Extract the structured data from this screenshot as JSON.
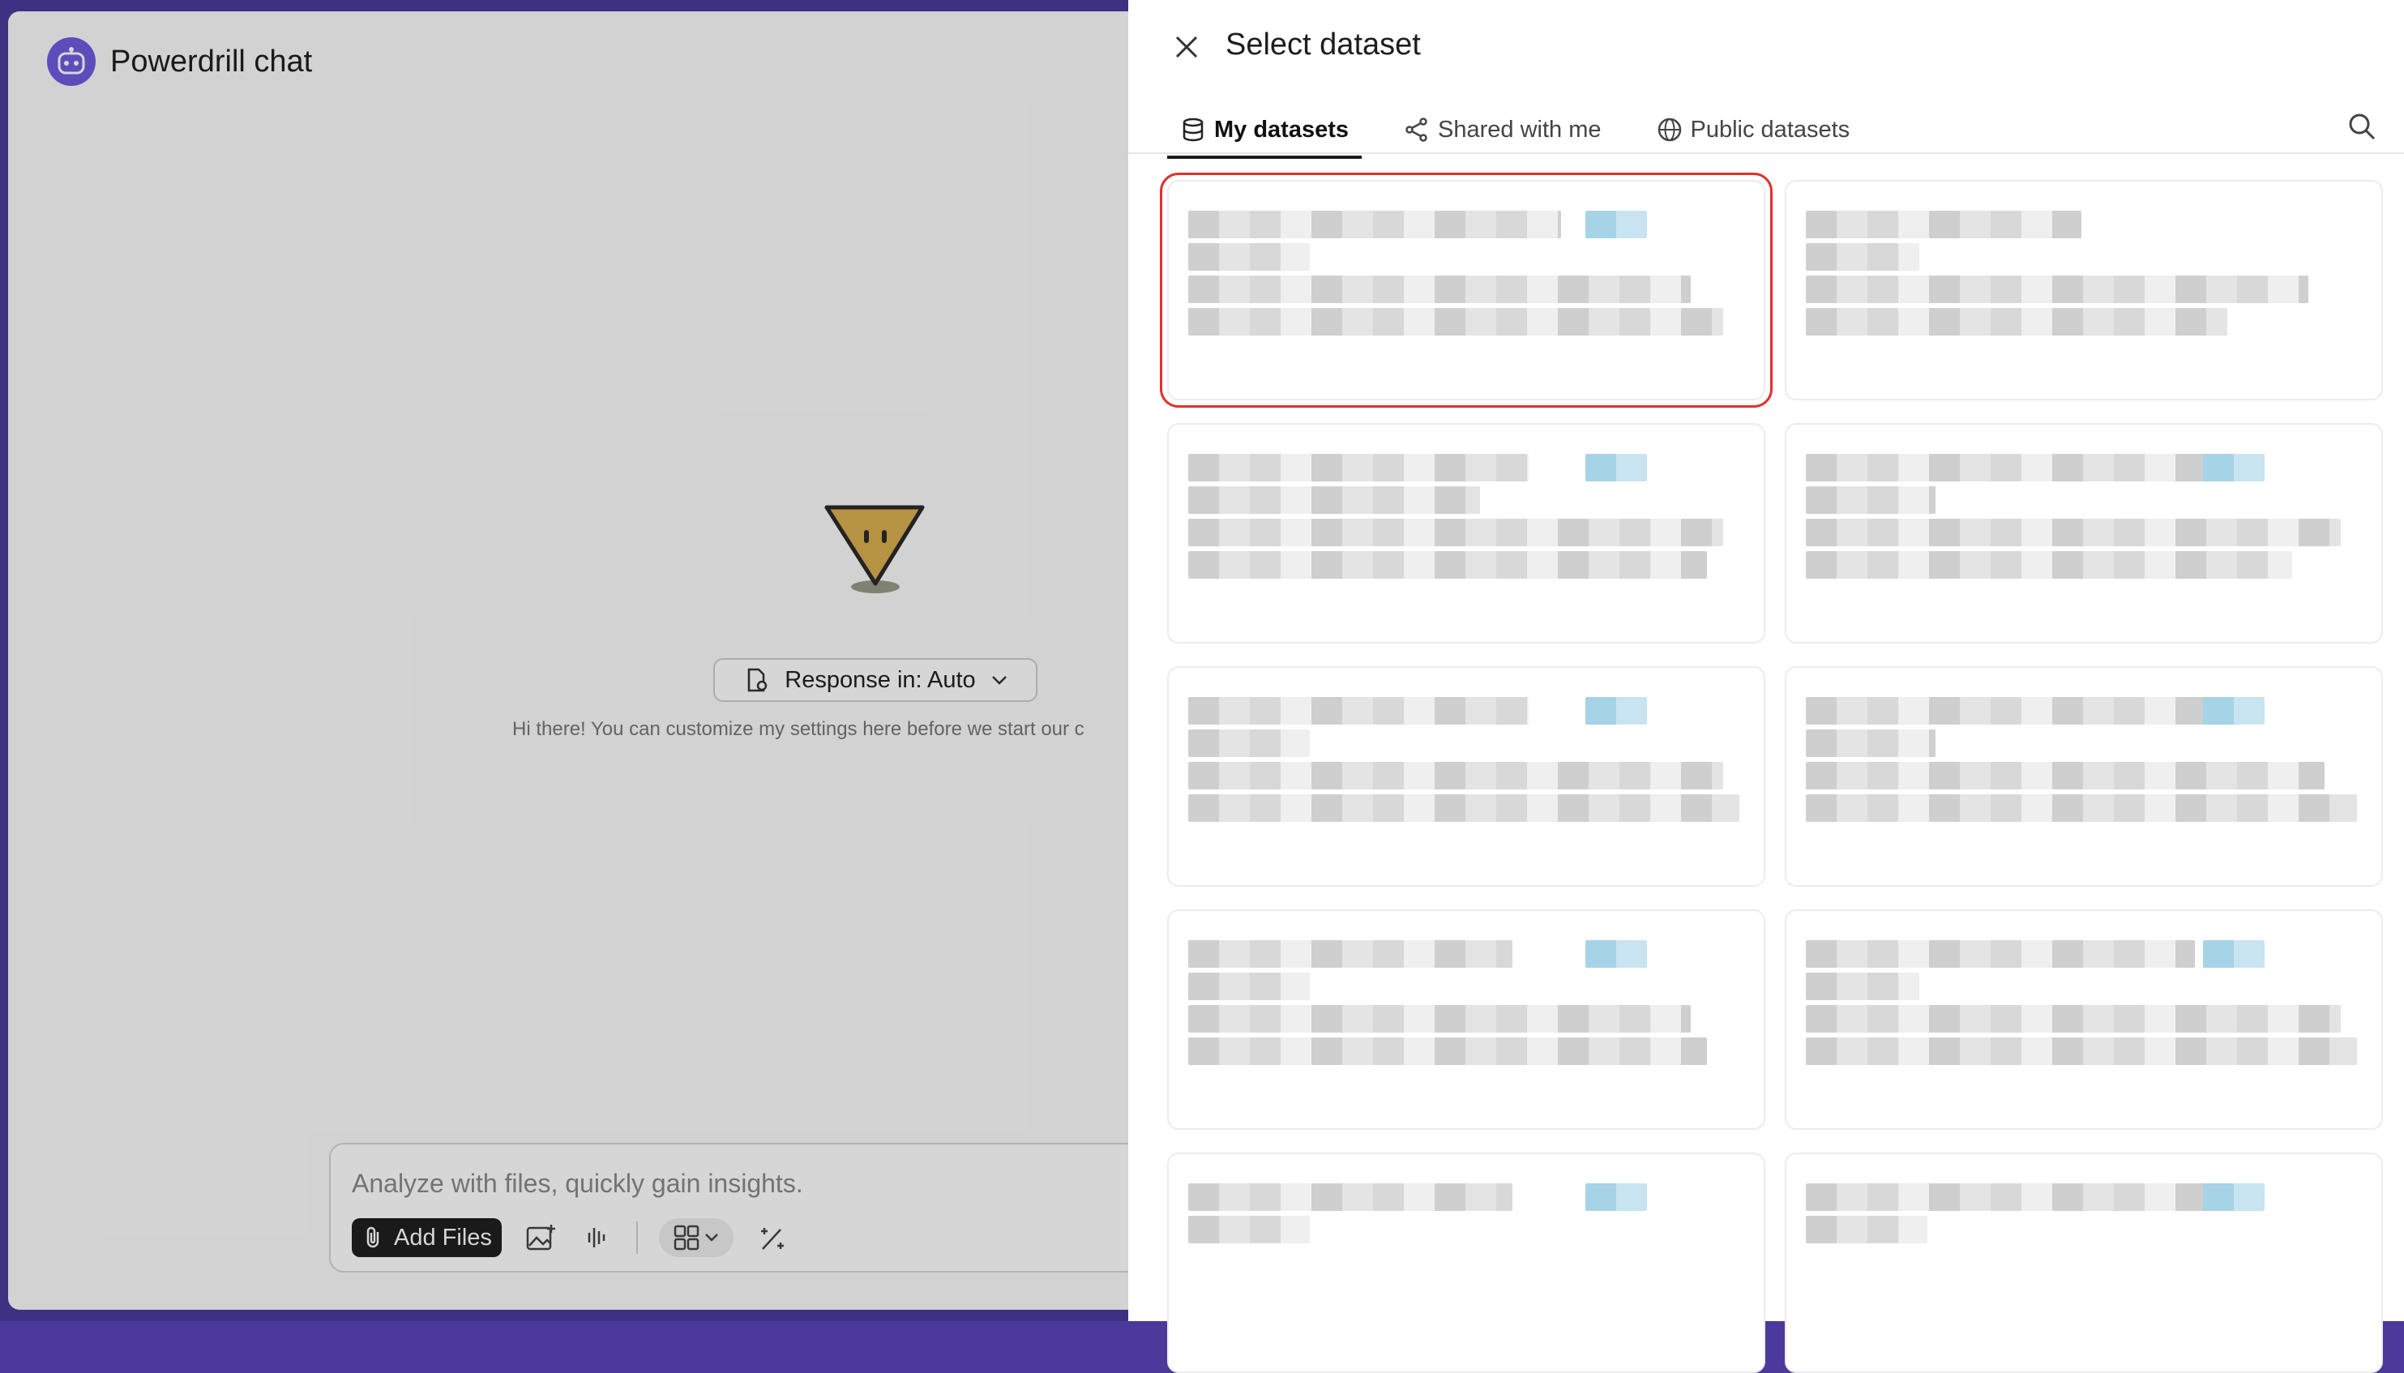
{
  "app": {
    "title": "Powerdrill chat",
    "response_mode_label": "Response in: Auto",
    "hint_text": "Hi there! You can customize my settings here before we start our c",
    "composer": {
      "placeholder": "Analyze with files, quickly gain insights.",
      "add_files_label": "Add Files"
    }
  },
  "drawer": {
    "title": "Select dataset",
    "tabs": [
      {
        "label": "My datasets",
        "icon": "database-icon",
        "active": true
      },
      {
        "label": "Shared with me",
        "icon": "share-icon",
        "active": false
      },
      {
        "label": "Public datasets",
        "icon": "globe-icon",
        "active": false
      }
    ]
  },
  "colors": {
    "brand": "#6f5be0",
    "frame": "#4b3a9c",
    "selection": "#e0322b",
    "mascot": "#d9b04f"
  }
}
